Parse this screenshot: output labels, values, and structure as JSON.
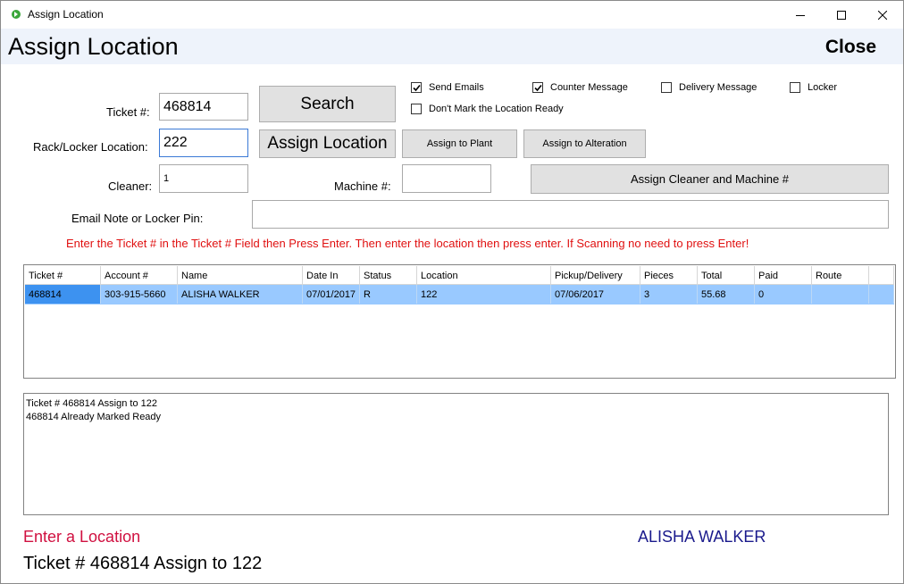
{
  "window": {
    "title": "Assign Location",
    "controls": {
      "minimize": "minimize",
      "maximize": "maximize",
      "close": "close"
    }
  },
  "header": {
    "title": "Assign Location",
    "close_label": "Close"
  },
  "form": {
    "ticket_label": "Ticket #:",
    "ticket_value": "468814",
    "location_label": "Rack/Locker Location:",
    "location_value": "222",
    "cleaner_label": "Cleaner:",
    "cleaner_value": "1",
    "machine_label": "Machine #:",
    "machine_value": "",
    "email_note_label": "Email Note or Locker Pin:",
    "email_note_value": ""
  },
  "buttons": {
    "search": "Search",
    "assign_location": "Assign Location",
    "assign_to_plant": "Assign to Plant",
    "assign_to_alteration": "Assign to Alteration",
    "assign_cleaner_machine": "Assign Cleaner and Machine #"
  },
  "options": {
    "send_emails": {
      "label": "Send Emails",
      "checked": true
    },
    "counter_message": {
      "label": "Counter Message",
      "checked": true
    },
    "delivery_message": {
      "label": "Delivery Message",
      "checked": false
    },
    "locker": {
      "label": "Locker",
      "checked": false
    },
    "dont_mark_ready": {
      "label": "Don't Mark the Location Ready",
      "checked": false
    }
  },
  "hint": "Enter the Ticket # in the Ticket # Field then Press Enter.  Then enter the location then press enter.  If Scanning no need to press Enter!",
  "grid": {
    "columns": [
      "Ticket #",
      "Account #",
      "Name",
      "Date In",
      "Status",
      "Location",
      "Pickup/Delivery",
      "Pieces",
      "Total",
      "Paid",
      "Route"
    ],
    "rows": [
      [
        "468814",
        "303-915-5660",
        "ALISHA WALKER",
        "07/01/2017",
        "R",
        "122",
        "07/06/2017",
        "3",
        "55.68",
        "0",
        ""
      ]
    ]
  },
  "log": {
    "lines": [
      "Ticket # 468814 Assign to 122",
      "468814 Already Marked Ready"
    ]
  },
  "status": {
    "prompt": "Enter a Location",
    "customer_name": "ALISHA WALKER",
    "last_action": "Ticket # 468814 Assign to 122"
  },
  "colors": {
    "header_band": "#eef3fb",
    "selected_row": "#99c9ff",
    "selected_cell": "#3d92f0",
    "hint_red": "#e01010",
    "prompt_red": "#d01040",
    "name_blue": "#1a1a8c"
  }
}
